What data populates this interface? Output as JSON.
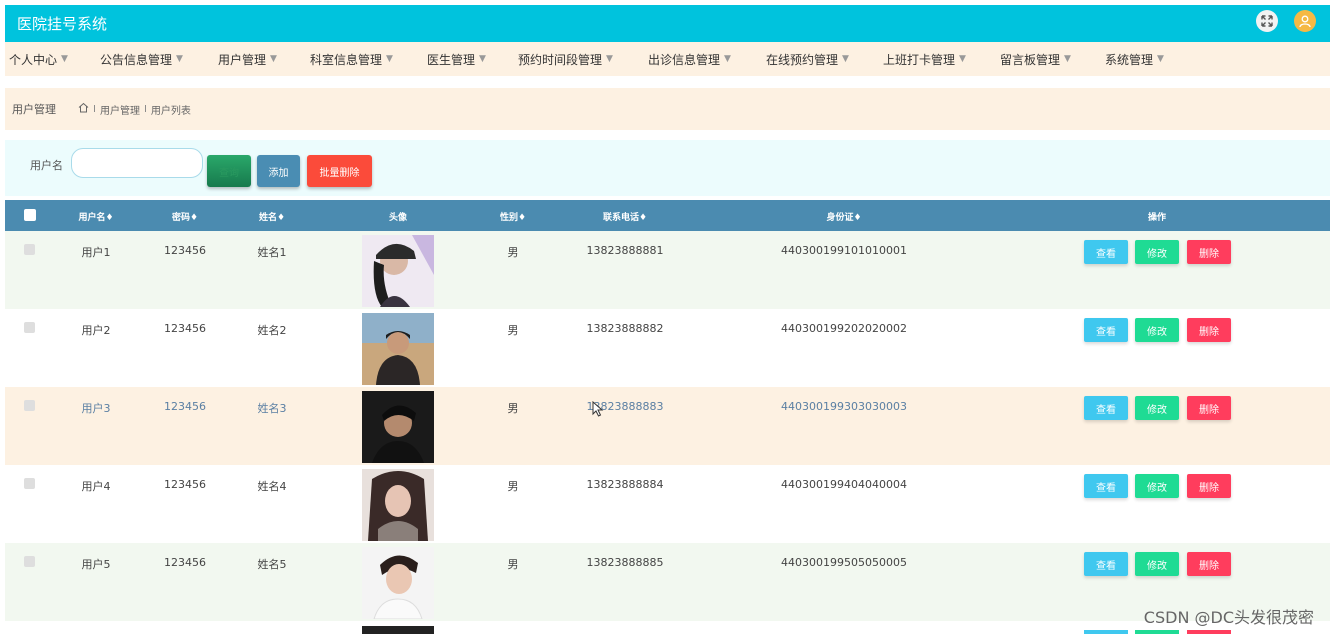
{
  "app": {
    "title": "医院挂号系统"
  },
  "menu": [
    {
      "label": "个人中心"
    },
    {
      "label": "公告信息管理"
    },
    {
      "label": "用户管理"
    },
    {
      "label": "科室信息管理"
    },
    {
      "label": "医生管理"
    },
    {
      "label": "预约时间段管理"
    },
    {
      "label": "出诊信息管理"
    },
    {
      "label": "在线预约管理"
    },
    {
      "label": "上班打卡管理"
    },
    {
      "label": "留言板管理"
    },
    {
      "label": "系统管理"
    }
  ],
  "breadcrumb": {
    "section": "用户管理",
    "path1": "用户管理",
    "path2": "用户列表",
    "sep": "I"
  },
  "search": {
    "label": "用户名",
    "value": "",
    "search_btn": "查询",
    "add_btn": "添加",
    "batch_delete_btn": "批量删除"
  },
  "table": {
    "headers": [
      "用户名",
      "密码",
      "姓名",
      "头像",
      "性别",
      "联系电话",
      "身份证",
      "操作"
    ],
    "sort_mark": "♦",
    "rows": [
      {
        "username": "用户1",
        "password": "123456",
        "name": "姓名1",
        "gender": "男",
        "phone": "13823888881",
        "id_card": "440300199101010001"
      },
      {
        "username": "用户2",
        "password": "123456",
        "name": "姓名2",
        "gender": "男",
        "phone": "13823888882",
        "id_card": "440300199202020002"
      },
      {
        "username": "用户3",
        "password": "123456",
        "name": "姓名3",
        "gender": "男",
        "phone": "13823888883",
        "id_card": "440300199303030003"
      },
      {
        "username": "用户4",
        "password": "123456",
        "name": "姓名4",
        "gender": "男",
        "phone": "13823888884",
        "id_card": "440300199404040004"
      },
      {
        "username": "用户5",
        "password": "123456",
        "name": "姓名5",
        "gender": "男",
        "phone": "13823888885",
        "id_card": "440300199505050005"
      }
    ],
    "actions": {
      "view": "查看",
      "edit": "修改",
      "delete": "删除"
    }
  },
  "colors": {
    "header": "#00c3dd",
    "menu_bg": "#fdf1e2",
    "table_head": "#4b8bb0",
    "row_alt": "#f2f8f0",
    "row_highlight": "#fdf1e2"
  },
  "watermark": "CSDN @DC头发很茂密"
}
